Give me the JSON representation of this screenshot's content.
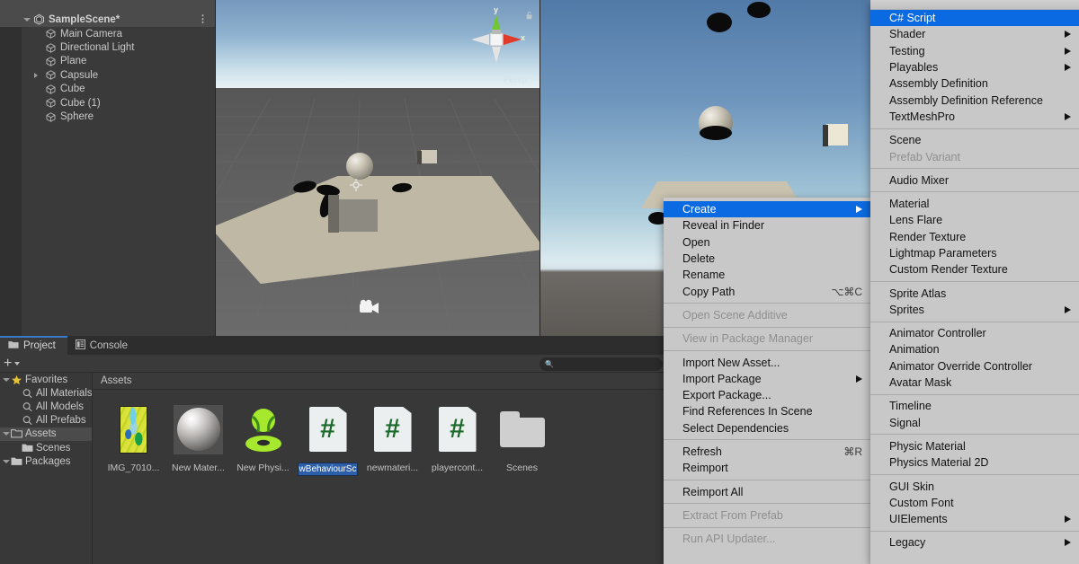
{
  "hierarchy": {
    "scene_name": "SampleScene*",
    "menu_icon": "kebab-menu-icon",
    "objects": [
      {
        "label": "Main Camera",
        "indent": 0,
        "expandable": false
      },
      {
        "label": "Directional Light",
        "indent": 0,
        "expandable": false
      },
      {
        "label": "Plane",
        "indent": 0,
        "expandable": false
      },
      {
        "label": "Capsule",
        "indent": 0,
        "expandable": true
      },
      {
        "label": "Cube",
        "indent": 0,
        "expandable": false
      },
      {
        "label": "Cube (1)",
        "indent": 0,
        "expandable": false
      },
      {
        "label": "Sphere",
        "indent": 0,
        "expandable": false
      }
    ]
  },
  "scene_view": {
    "gizmo_axis_x": "x",
    "gizmo_axis_y": "y",
    "projection_label": "Persp",
    "lock_icon": "lock-icon"
  },
  "project": {
    "tabs": [
      {
        "label": "Project",
        "icon": "folder-icon",
        "active": true
      },
      {
        "label": "Console",
        "icon": "console-icon",
        "active": false
      }
    ],
    "toolbar": {
      "add_label": "+",
      "search_placeholder": "",
      "search_value": "",
      "search_icon": "search-icon"
    },
    "tree": [
      {
        "label": "Favorites",
        "icon": "star-icon",
        "indent": 0,
        "expandable": true,
        "selected": false
      },
      {
        "label": "All Materials",
        "icon": "search-icon",
        "indent": 1,
        "expandable": false,
        "selected": false
      },
      {
        "label": "All Models",
        "icon": "search-icon",
        "indent": 1,
        "expandable": false,
        "selected": false
      },
      {
        "label": "All Prefabs",
        "icon": "search-icon",
        "indent": 1,
        "expandable": false,
        "selected": false
      },
      {
        "label": "Assets",
        "icon": "folder-open-icon",
        "indent": 0,
        "expandable": true,
        "selected": true
      },
      {
        "label": "Scenes",
        "icon": "folder-icon",
        "indent": 1,
        "expandable": false,
        "selected": false
      },
      {
        "label": "Packages",
        "icon": "folder-icon",
        "indent": 0,
        "expandable": true,
        "selected": false
      }
    ],
    "breadcrumb": "Assets",
    "assets": [
      {
        "label": "IMG_7010...",
        "kind": "texture",
        "editing": false
      },
      {
        "label": "New Mater...",
        "kind": "material",
        "editing": false
      },
      {
        "label": "New Physi...",
        "kind": "physic-material",
        "editing": false
      },
      {
        "label": "wBehaviourSc",
        "kind": "script",
        "editing": true
      },
      {
        "label": "newmateri...",
        "kind": "script",
        "editing": false
      },
      {
        "label": "playercont...",
        "kind": "script",
        "editing": false
      },
      {
        "label": "Scenes",
        "kind": "folder",
        "editing": false
      }
    ]
  },
  "context_menu_asset": {
    "groups": [
      [
        {
          "label": "Create",
          "submenu": true,
          "highlighted": true,
          "disabled": false,
          "shortcut": ""
        },
        {
          "label": "Reveal in Finder",
          "submenu": false,
          "highlighted": false,
          "disabled": false,
          "shortcut": ""
        },
        {
          "label": "Open",
          "submenu": false,
          "highlighted": false,
          "disabled": false,
          "shortcut": ""
        },
        {
          "label": "Delete",
          "submenu": false,
          "highlighted": false,
          "disabled": false,
          "shortcut": ""
        },
        {
          "label": "Rename",
          "submenu": false,
          "highlighted": false,
          "disabled": false,
          "shortcut": ""
        },
        {
          "label": "Copy Path",
          "submenu": false,
          "highlighted": false,
          "disabled": false,
          "shortcut": "⌥⌘C"
        }
      ],
      [
        {
          "label": "Open Scene Additive",
          "submenu": false,
          "highlighted": false,
          "disabled": true,
          "shortcut": ""
        }
      ],
      [
        {
          "label": "View in Package Manager",
          "submenu": false,
          "highlighted": false,
          "disabled": true,
          "shortcut": ""
        }
      ],
      [
        {
          "label": "Import New Asset...",
          "submenu": false,
          "highlighted": false,
          "disabled": false,
          "shortcut": ""
        },
        {
          "label": "Import Package",
          "submenu": true,
          "highlighted": false,
          "disabled": false,
          "shortcut": ""
        },
        {
          "label": "Export Package...",
          "submenu": false,
          "highlighted": false,
          "disabled": false,
          "shortcut": ""
        },
        {
          "label": "Find References In Scene",
          "submenu": false,
          "highlighted": false,
          "disabled": false,
          "shortcut": ""
        },
        {
          "label": "Select Dependencies",
          "submenu": false,
          "highlighted": false,
          "disabled": false,
          "shortcut": ""
        }
      ],
      [
        {
          "label": "Refresh",
          "submenu": false,
          "highlighted": false,
          "disabled": false,
          "shortcut": "⌘R"
        },
        {
          "label": "Reimport",
          "submenu": false,
          "highlighted": false,
          "disabled": false,
          "shortcut": ""
        }
      ],
      [
        {
          "label": "Reimport All",
          "submenu": false,
          "highlighted": false,
          "disabled": false,
          "shortcut": ""
        }
      ],
      [
        {
          "label": "Extract From Prefab",
          "submenu": false,
          "highlighted": false,
          "disabled": true,
          "shortcut": ""
        }
      ],
      [
        {
          "label": "Run API Updater...",
          "submenu": false,
          "highlighted": false,
          "disabled": true,
          "shortcut": ""
        }
      ]
    ]
  },
  "context_menu_create": {
    "scroll_indicator": true,
    "groups": [
      [
        {
          "label": "C# Script",
          "submenu": false,
          "highlighted": true,
          "disabled": false
        },
        {
          "label": "Shader",
          "submenu": true,
          "highlighted": false,
          "disabled": false
        },
        {
          "label": "Testing",
          "submenu": true,
          "highlighted": false,
          "disabled": false
        },
        {
          "label": "Playables",
          "submenu": true,
          "highlighted": false,
          "disabled": false
        },
        {
          "label": "Assembly Definition",
          "submenu": false,
          "highlighted": false,
          "disabled": false
        },
        {
          "label": "Assembly Definition Reference",
          "submenu": false,
          "highlighted": false,
          "disabled": false
        },
        {
          "label": "TextMeshPro",
          "submenu": true,
          "highlighted": false,
          "disabled": false
        }
      ],
      [
        {
          "label": "Scene",
          "submenu": false,
          "highlighted": false,
          "disabled": false
        },
        {
          "label": "Prefab Variant",
          "submenu": false,
          "highlighted": false,
          "disabled": true
        }
      ],
      [
        {
          "label": "Audio Mixer",
          "submenu": false,
          "highlighted": false,
          "disabled": false
        }
      ],
      [
        {
          "label": "Material",
          "submenu": false,
          "highlighted": false,
          "disabled": false
        },
        {
          "label": "Lens Flare",
          "submenu": false,
          "highlighted": false,
          "disabled": false
        },
        {
          "label": "Render Texture",
          "submenu": false,
          "highlighted": false,
          "disabled": false
        },
        {
          "label": "Lightmap Parameters",
          "submenu": false,
          "highlighted": false,
          "disabled": false
        },
        {
          "label": "Custom Render Texture",
          "submenu": false,
          "highlighted": false,
          "disabled": false
        }
      ],
      [
        {
          "label": "Sprite Atlas",
          "submenu": false,
          "highlighted": false,
          "disabled": false
        },
        {
          "label": "Sprites",
          "submenu": true,
          "highlighted": false,
          "disabled": false
        }
      ],
      [
        {
          "label": "Animator Controller",
          "submenu": false,
          "highlighted": false,
          "disabled": false
        },
        {
          "label": "Animation",
          "submenu": false,
          "highlighted": false,
          "disabled": false
        },
        {
          "label": "Animator Override Controller",
          "submenu": false,
          "highlighted": false,
          "disabled": false
        },
        {
          "label": "Avatar Mask",
          "submenu": false,
          "highlighted": false,
          "disabled": false
        }
      ],
      [
        {
          "label": "Timeline",
          "submenu": false,
          "highlighted": false,
          "disabled": false
        },
        {
          "label": "Signal",
          "submenu": false,
          "highlighted": false,
          "disabled": false
        }
      ],
      [
        {
          "label": "Physic Material",
          "submenu": false,
          "highlighted": false,
          "disabled": false
        },
        {
          "label": "Physics Material 2D",
          "submenu": false,
          "highlighted": false,
          "disabled": false
        }
      ],
      [
        {
          "label": "GUI Skin",
          "submenu": false,
          "highlighted": false,
          "disabled": false
        },
        {
          "label": "Custom Font",
          "submenu": false,
          "highlighted": false,
          "disabled": false
        },
        {
          "label": "UIElements",
          "submenu": true,
          "highlighted": false,
          "disabled": false
        }
      ],
      [
        {
          "label": "Legacy",
          "submenu": true,
          "highlighted": false,
          "disabled": false
        }
      ]
    ]
  },
  "colors": {
    "accent_blue": "#0a6ae1",
    "tab_accent": "#3a79c8",
    "panel_bg": "#383838",
    "menu_bg": "#c8c8c8"
  }
}
